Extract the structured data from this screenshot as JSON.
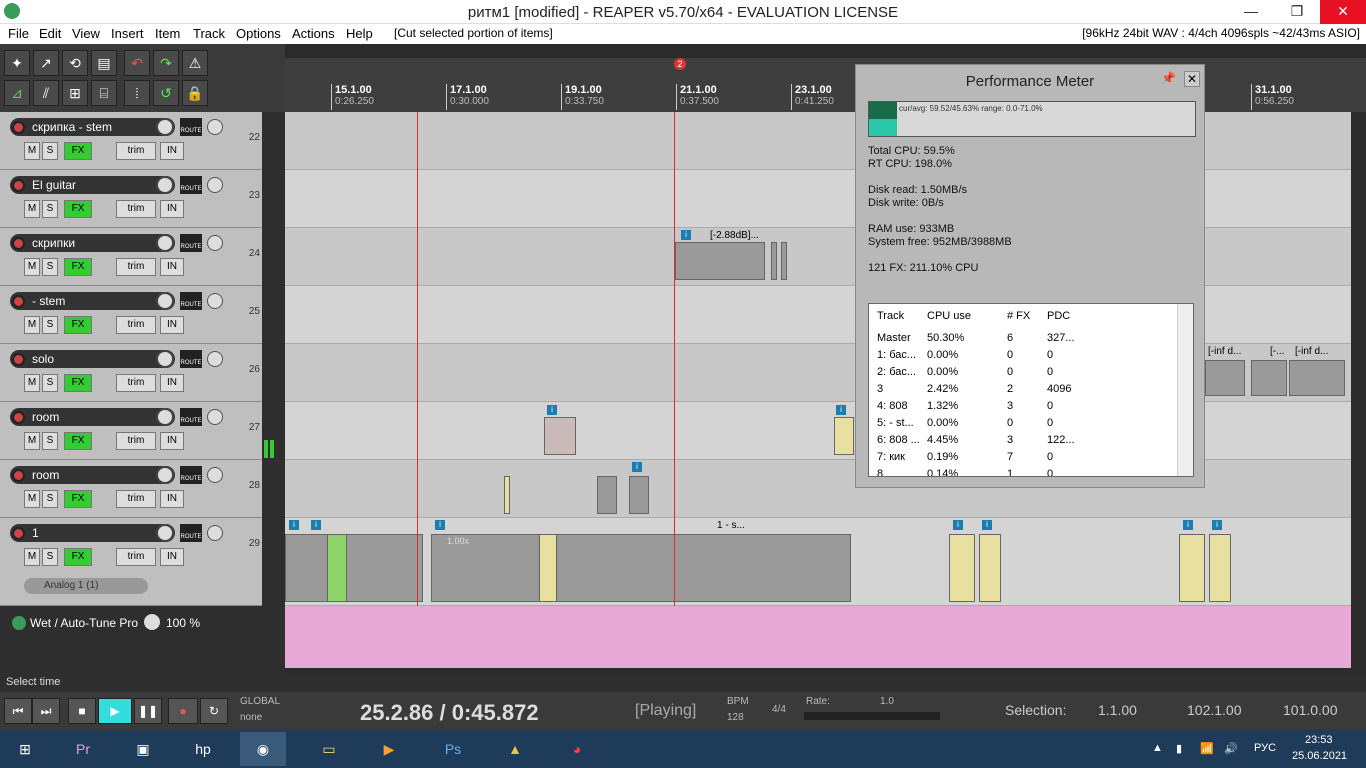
{
  "window": {
    "title": "ритм1 [modified] - REAPER v5.70/x64 - EVALUATION LICENSE",
    "min": "—",
    "max": "❐",
    "close": "✕"
  },
  "menu": {
    "items": [
      "File",
      "Edit",
      "View",
      "Insert",
      "Item",
      "Track",
      "Options",
      "Actions",
      "Help"
    ],
    "hint": "[Cut selected portion of items]",
    "format": "[96kHz 24bit WAV : 4/4ch 4096spls ~42/43ms ASIO]"
  },
  "ruler": {
    "ticks": [
      {
        "bar": "15.1.00",
        "time": "0:26.250"
      },
      {
        "bar": "17.1.00",
        "time": "0:30.000"
      },
      {
        "bar": "19.1.00",
        "time": "0:33.750"
      },
      {
        "bar": "21.1.00",
        "time": "0:37.500"
      },
      {
        "bar": "23.1.00",
        "time": "0:41.250"
      },
      {
        "bar": "31.1.00",
        "time": "0:56.250"
      }
    ],
    "marker": "2"
  },
  "tracks": [
    {
      "name": "скрипка - stem",
      "num": "22"
    },
    {
      "name": "El guitar",
      "num": "23"
    },
    {
      "name": "скрипки",
      "num": "24"
    },
    {
      "name": "- stem",
      "num": "25"
    },
    {
      "name": "solo",
      "num": "26"
    },
    {
      "name": "room",
      "num": "27"
    },
    {
      "name": "room",
      "num": "28"
    },
    {
      "name": "1",
      "num": "29"
    }
  ],
  "track_controls": {
    "mute": "M",
    "solo": "S",
    "fx": "FX",
    "trim": "trim",
    "in": "IN",
    "route": "ROUTE"
  },
  "track29_plugin": "Analog 1 (1)",
  "envelope": {
    "label": "Wet / Auto-Tune Pro",
    "value": "100 %"
  },
  "items": {
    "db_label": "[-2.88dB]...",
    "item_1s": "1 - s...",
    "inf1": "[-inf d...",
    "inf2": "[-...",
    "inf3": "[-inf d...",
    "rate": "1.00x"
  },
  "status": {
    "text": "Select time"
  },
  "transport": {
    "time": "25.2.86 / 0:45.872",
    "state": "[Playing]",
    "bpm_label": "BPM",
    "bpm": "128",
    "sig": "4/4",
    "rate_label": "Rate:",
    "rate": "1.0",
    "global": "GLOBAL",
    "none": "none",
    "selection_label": "Selection:",
    "sel_start": "1.1.00",
    "sel_end": "102.1.00",
    "sel_len": "101.0.00"
  },
  "perf": {
    "title": "Performance Meter",
    "graph_text": "cur/avg: 59.52/45.63%  range: 0.0-71.0%",
    "total_cpu": "Total CPU: 59.5%",
    "rt_cpu": "RT CPU: 198.0%",
    "disk_read": "Disk read: 1.50MB/s",
    "disk_write": "Disk write: 0B/s",
    "ram": "RAM use: 933MB",
    "sys_free": "System free: 952MB/3988MB",
    "fx": "121 FX: 211.10% CPU",
    "columns": [
      "Track",
      "CPU use",
      "# FX",
      "PDC"
    ],
    "rows": [
      [
        "Master",
        "50.30%",
        "6",
        "327..."
      ],
      [
        "1: бас...",
        "0.00%",
        "0",
        "0"
      ],
      [
        "2: бас...",
        "0.00%",
        "0",
        "0"
      ],
      [
        "3",
        "2.42%",
        "2",
        "4096"
      ],
      [
        "4: 808",
        "1.32%",
        "3",
        "0"
      ],
      [
        "5: - st...",
        "0.00%",
        "0",
        "0"
      ],
      [
        "6: 808 ...",
        "4.45%",
        "3",
        "122..."
      ],
      [
        "7: кик",
        "0.19%",
        "7",
        "0"
      ],
      [
        "8",
        "0.14%",
        "1",
        "0"
      ]
    ]
  },
  "taskbar": {
    "lang": "РУС",
    "time": "23:53",
    "date": "25.06.2021"
  },
  "colors": {
    "accent": "#3c3",
    "envelope": "#e6a8d4",
    "marker": "#d33"
  }
}
